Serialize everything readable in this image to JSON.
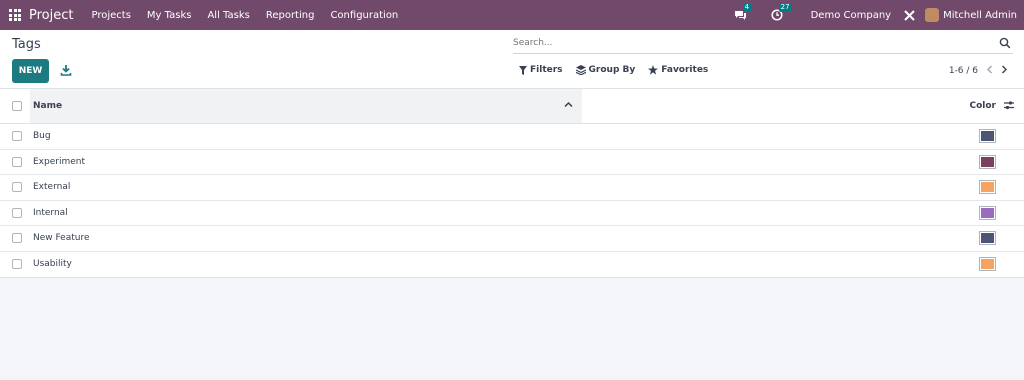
{
  "navbar": {
    "app_name": "Project",
    "menu": [
      "Projects",
      "My Tasks",
      "All Tasks",
      "Reporting",
      "Configuration"
    ],
    "messages_count": "4",
    "activities_count": "27",
    "company": "Demo Company",
    "user": "Mitchell Admin"
  },
  "page": {
    "title": "Tags",
    "new_label": "NEW"
  },
  "search": {
    "placeholder": "Search..."
  },
  "toolbar": {
    "filters": "Filters",
    "group_by": "Group By",
    "favorites": "Favorites"
  },
  "pager": {
    "value": "1-6 / 6"
  },
  "table": {
    "col_name": "Name",
    "col_color": "Color",
    "rows": [
      {
        "name": "Bug",
        "color": "#4c5574"
      },
      {
        "name": "Experiment",
        "color": "#7b3f61"
      },
      {
        "name": "External",
        "color": "#f4a460"
      },
      {
        "name": "Internal",
        "color": "#9b6bc0"
      },
      {
        "name": "New Feature",
        "color": "#4c5574"
      },
      {
        "name": "Usability",
        "color": "#f4a460"
      }
    ]
  },
  "colors": {
    "navbar": "#71496a",
    "primary": "#1c7b80",
    "badge": "#017e84"
  }
}
